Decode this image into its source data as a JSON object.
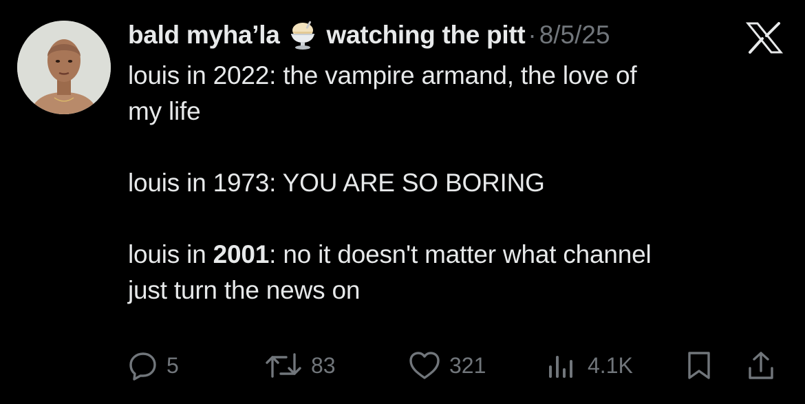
{
  "author": {
    "display_name": "bald myha’la",
    "name_suffix": "watching the pitt",
    "name_emoji": "ice-cream-sundae-icon",
    "date": "8/5/25",
    "separator": "·"
  },
  "tweet": {
    "lines": [
      "louis in 2022: the vampire armand, the love of",
      "my life",
      "louis in 1973: YOU ARE SO BORING",
      "louis in ",
      "2001",
      ": no it doesn't matter what channel",
      "just turn the news on"
    ]
  },
  "actions": {
    "replies": "5",
    "reposts": "83",
    "likes": "321",
    "views": "4.1K"
  },
  "colors": {
    "background": "#000000",
    "text": "#e7e9ea",
    "muted": "#71767b"
  },
  "icons": {
    "platform": "x-logo-icon",
    "reply": "reply-icon",
    "repost": "repost-icon",
    "like": "heart-icon",
    "views": "views-icon",
    "bookmark": "bookmark-icon",
    "share": "share-icon"
  }
}
